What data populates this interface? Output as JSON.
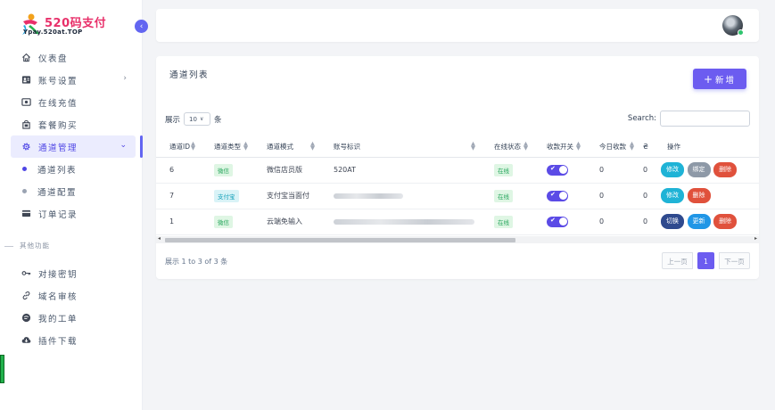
{
  "logo": {
    "brand": "520码支付",
    "url": "Ypay.520at.TOP"
  },
  "sidebar": {
    "items": [
      {
        "label": "仪表盘",
        "icon": "home-icon"
      },
      {
        "label": "账号设置",
        "icon": "profile-icon"
      },
      {
        "label": "在线充值",
        "icon": "wallet-icon"
      },
      {
        "label": "套餐购买",
        "icon": "bag-icon"
      },
      {
        "label": "通道管理",
        "icon": "gear-icon"
      },
      {
        "label": "订单记录",
        "icon": "card-icon"
      }
    ],
    "sub_items": [
      {
        "label": "通道列表"
      },
      {
        "label": "通道配置"
      }
    ],
    "section_title": "其他功能",
    "other_items": [
      {
        "label": "对接密钥",
        "icon": "key-icon"
      },
      {
        "label": "域名审核",
        "icon": "link-icon"
      },
      {
        "label": "我的工单",
        "icon": "chat-icon"
      },
      {
        "label": "插件下载",
        "icon": "cloud-download-icon"
      }
    ]
  },
  "card": {
    "title": "通道列表",
    "add_label": "新增",
    "length_prefix": "展示",
    "length_value": "10",
    "length_suffix": "条",
    "search_label": "Search:",
    "info": "展示 1 to 3 of 3 条"
  },
  "table": {
    "headers": [
      "通道ID",
      "通道类型",
      "通道模式",
      "账号标识",
      "在线状态",
      "收款开关",
      "今日收款",
      "₴",
      "操作"
    ],
    "rows": [
      {
        "id": "6",
        "type": "微信",
        "type_color": "green",
        "mode": "微信店员版",
        "account": "520AT",
        "status": "在线",
        "today": "0",
        "extra": "0",
        "actions": [
          {
            "label": "修改",
            "color": "cyan"
          },
          {
            "label": "绑定",
            "color": "gray"
          },
          {
            "label": "删除",
            "color": "red"
          }
        ]
      },
      {
        "id": "7",
        "type": "支付宝",
        "type_color": "cyan",
        "mode": "支付宝当面付",
        "account": "",
        "status": "在线",
        "today": "0",
        "extra": "0",
        "actions": [
          {
            "label": "修改",
            "color": "cyan"
          },
          {
            "label": "删除",
            "color": "red"
          }
        ]
      },
      {
        "id": "1",
        "type": "微信",
        "type_color": "green",
        "mode": "云端免输入",
        "account": "",
        "status": "在线",
        "today": "0",
        "extra": "0",
        "actions": [
          {
            "label": "切换",
            "color": "navy"
          },
          {
            "label": "更新",
            "color": "blue"
          },
          {
            "label": "删除",
            "color": "red"
          }
        ]
      }
    ]
  },
  "pager": {
    "prev": "上一页",
    "current": "1",
    "next": "下一页"
  },
  "colors": {
    "accent": "#6366f1",
    "success": "#23a45a",
    "danger": "#e0513c"
  }
}
